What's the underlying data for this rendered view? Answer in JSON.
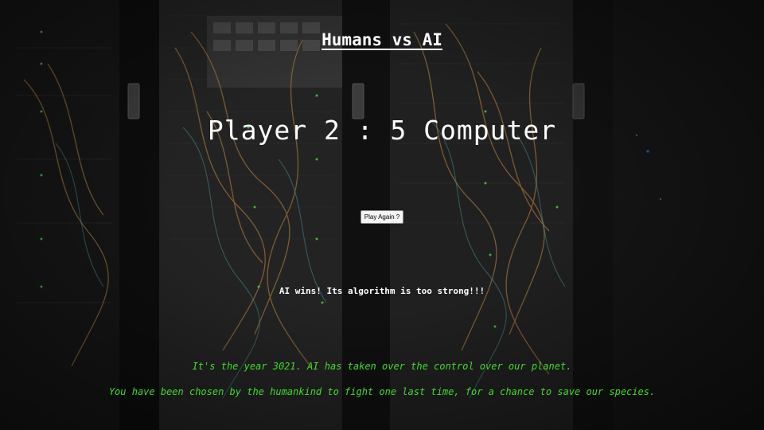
{
  "page": {
    "title": "Humans vs AI"
  },
  "scoreboard": {
    "text": "Player 2 : 5 Computer"
  },
  "controls": {
    "play_again_label": "Play Again ?"
  },
  "result": {
    "message": "AI wins! Its algorithm is too strong!!!"
  },
  "story": {
    "line1": "It's the year 3021. AI has taken over the control over our planet.",
    "line2": "You have been chosen by the humankind to fight one last time, for a chance to save our species."
  },
  "colors": {
    "text": "#ffffff",
    "story_text": "#3fdc2a",
    "background": "#141414"
  },
  "background_image": {
    "icon": "server-room-image"
  }
}
